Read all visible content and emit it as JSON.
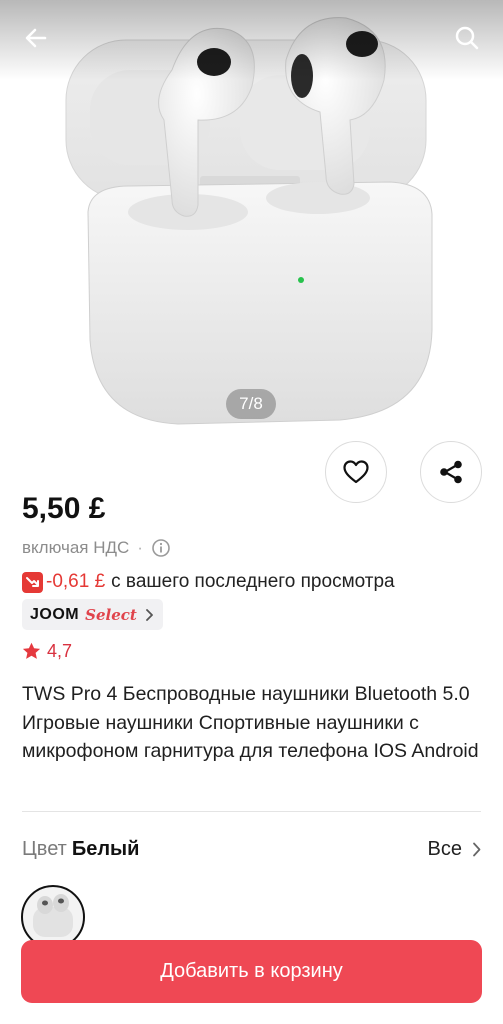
{
  "gallery": {
    "counter": "7/8",
    "icons": {
      "back": "arrow-left-icon",
      "search": "search-icon"
    }
  },
  "actions": {
    "favorite_icon": "heart-icon",
    "share_icon": "share-icon"
  },
  "product": {
    "price": "5,50 £",
    "vat_note": "включая НДС",
    "vat_separator": "·",
    "price_drop": {
      "value": "-0,61 £",
      "text": "с вашего последнего просмотра",
      "color": "#e53935"
    },
    "badge": {
      "brand": "JOOM",
      "tier": "Select"
    },
    "rating": "4,7",
    "title": "TWS Pro 4 Беспроводные наушники Bluetooth 5.0 Игровые наушники Спортивные наушники с микрофоном гарнитура для телефона IOS Android"
  },
  "variant": {
    "label": "Цвет",
    "value": "Белый",
    "all_link": "Все"
  },
  "cart": {
    "label": "Добавить в корзину",
    "color": "#ef4854"
  }
}
